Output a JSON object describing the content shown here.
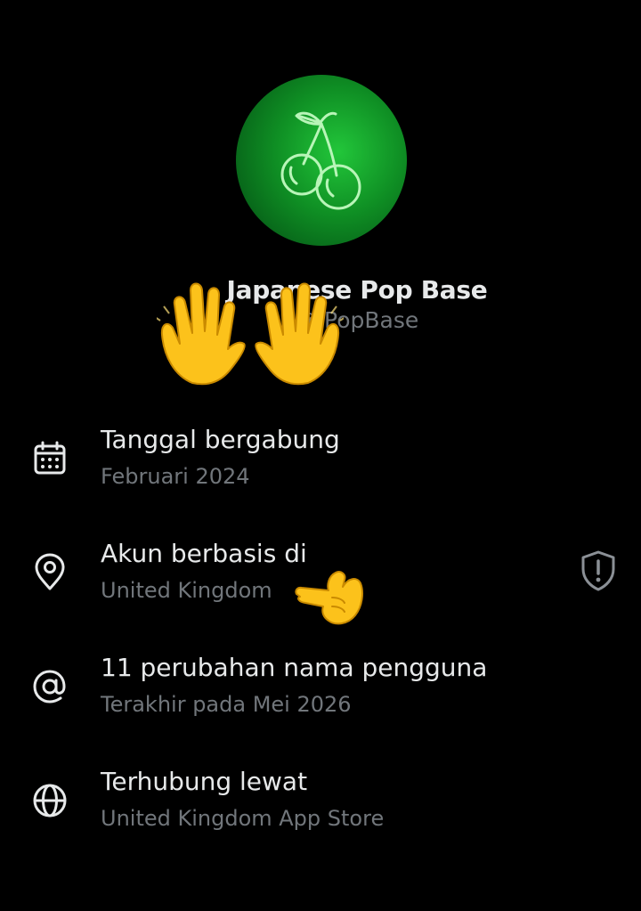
{
  "profile": {
    "display_name": "Japanese Pop Base",
    "handle": "@JPopBase",
    "avatar_icon": "cherry-icon",
    "avatar_color": "#12a82a"
  },
  "info_rows": [
    {
      "title": "Tanggal bergabung",
      "subtitle": "Februari 2024",
      "icon": "calendar-icon"
    },
    {
      "title": "Akun berbasis di",
      "subtitle": "United Kingdom",
      "icon": "location-pin-icon",
      "trailing_icon": "shield-alert-icon"
    },
    {
      "title": "11 perubahan nama pengguna",
      "subtitle": "Terakhir pada Mei 2026",
      "icon": "at-sign-icon"
    },
    {
      "title": "Terhubung lewat",
      "subtitle": "United Kingdom App Store",
      "icon": "globe-icon"
    }
  ],
  "overlays": {
    "raised_hands": "raised-hands-emoji",
    "pointing_hand": "backhand-index-pointing-left-emoji"
  },
  "colors": {
    "background": "#000000",
    "primary_text": "#e7e9ea",
    "secondary_text": "#71767b"
  }
}
